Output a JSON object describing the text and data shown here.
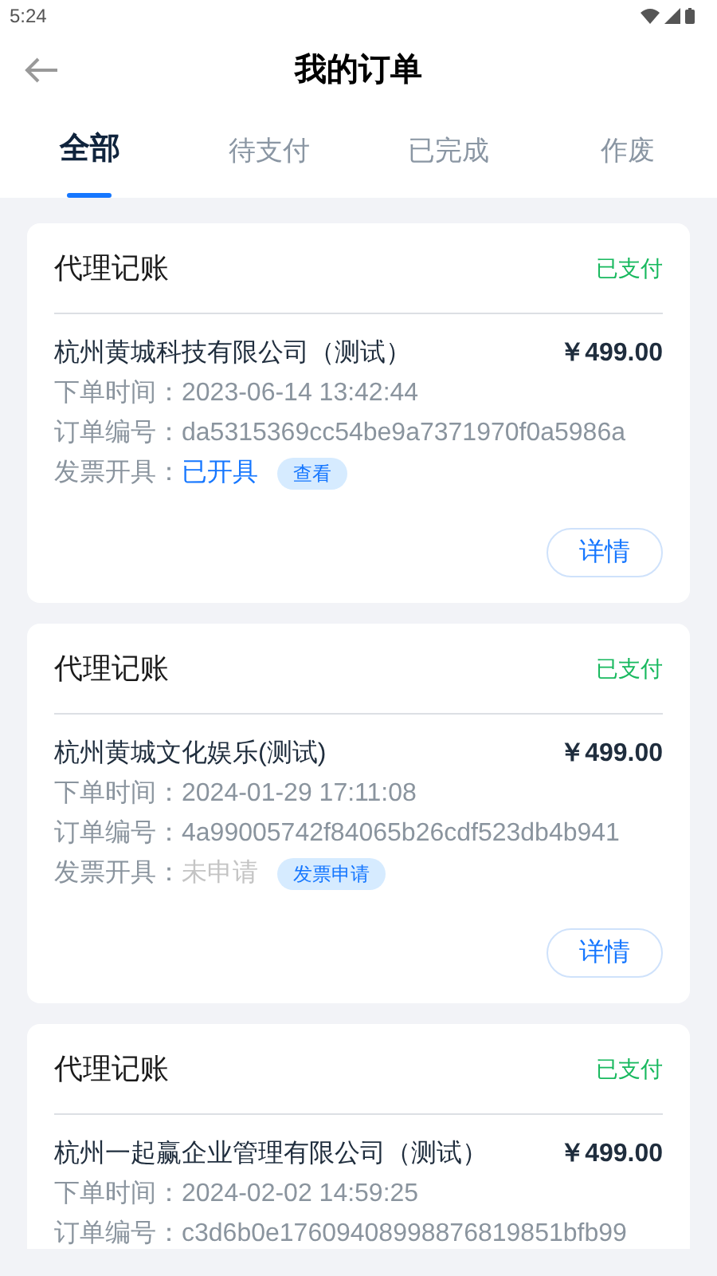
{
  "status_bar": {
    "time": "5:24"
  },
  "header": {
    "title": "我的订单"
  },
  "tabs": [
    {
      "label": "全部",
      "selected": true
    },
    {
      "label": "待支付",
      "selected": false
    },
    {
      "label": "已完成",
      "selected": false
    },
    {
      "label": "作废",
      "selected": false
    }
  ],
  "orders": [
    {
      "service": "代理记账",
      "status": "已支付",
      "company": "杭州黄城科技有限公司（测试）",
      "price": "￥499.00",
      "time_label": "下单时间：",
      "time": "2023-06-14 13:42:44",
      "number_label": "订单编号：",
      "number": "da5315369cc54be9a7371970f0a5986a",
      "invoice_label": "发票开具：",
      "invoice_status": "已开具",
      "invoice_issued": true,
      "invoice_action": "查看",
      "details": "详情"
    },
    {
      "service": "代理记账",
      "status": "已支付",
      "company": "杭州黄城文化娱乐(测试)",
      "price": "￥499.00",
      "time_label": "下单时间：",
      "time": "2024-01-29 17:11:08",
      "number_label": "订单编号：",
      "number": "4a99005742f84065b26cdf523db4b941",
      "invoice_label": "发票开具：",
      "invoice_status": "未申请",
      "invoice_issued": false,
      "invoice_action": "发票申请",
      "details": "详情"
    },
    {
      "service": "代理记账",
      "status": "已支付",
      "company": "杭州一起赢企业管理有限公司（测试）",
      "price": "￥499.00",
      "time_label": "下单时间：",
      "time": "2024-02-02 14:59:25",
      "number_label": "订单编号：",
      "number": "c3d6b0e17609408998876819851bfb99"
    }
  ]
}
